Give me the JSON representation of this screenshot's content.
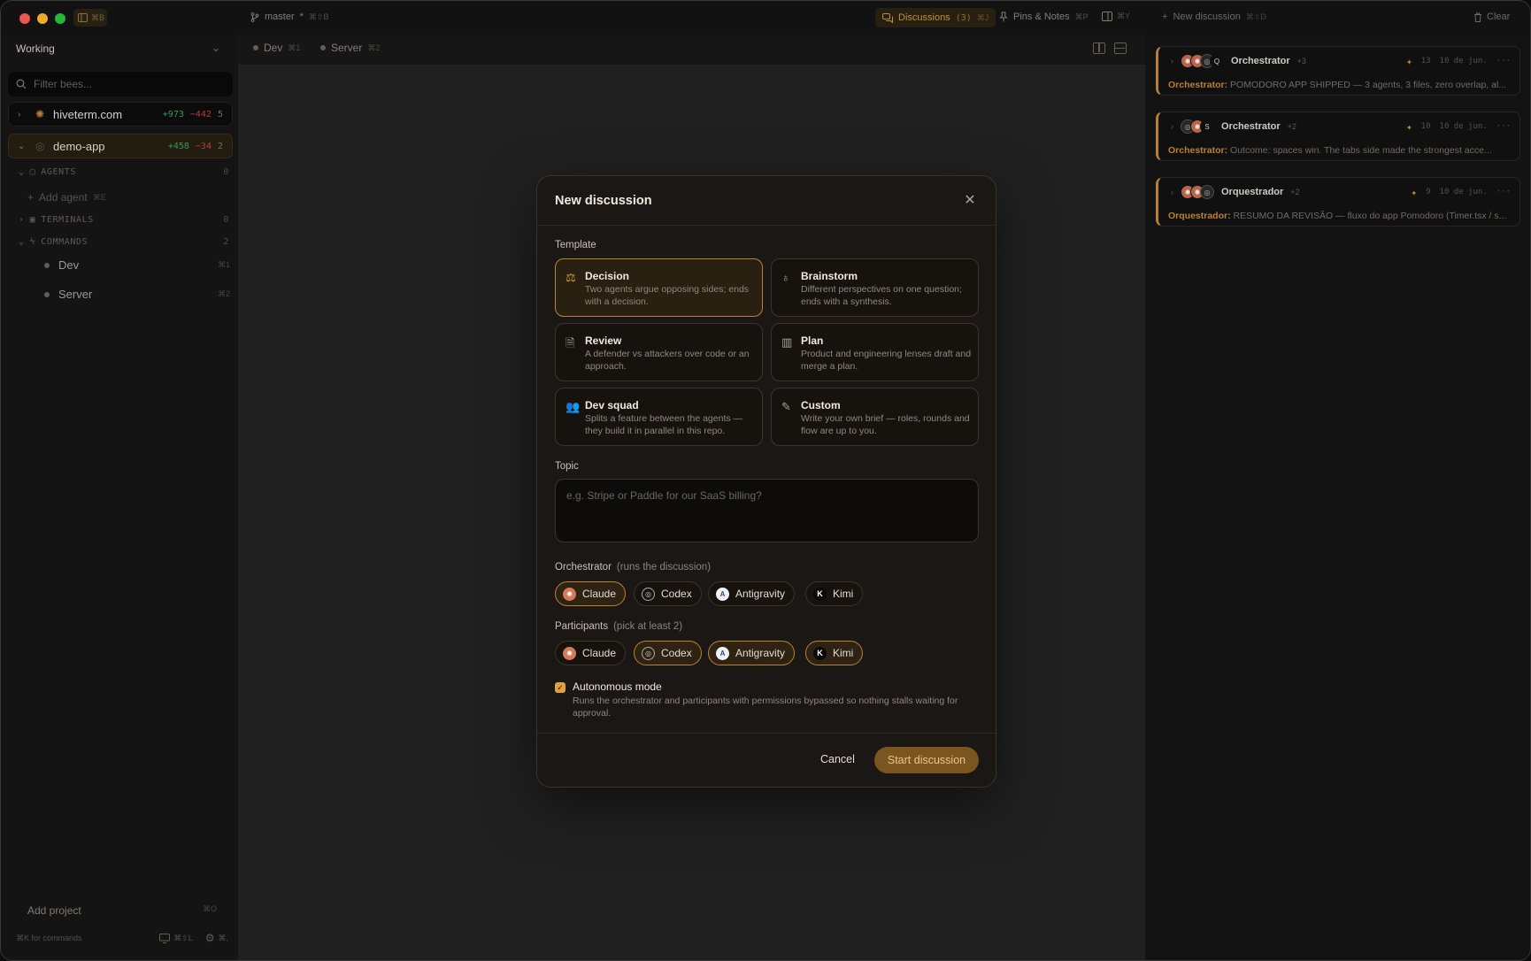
{
  "topbar": {
    "sidebar_kbd": "⌘B",
    "branch": "master",
    "branch_mark": "*",
    "branch_extra": "⌘⇧B",
    "discussions_label": "Discussions",
    "discussions_count": "(3)",
    "discussions_kbd": "⌘J",
    "pins_label": "Pins & Notes",
    "pins_kbd": "⌘P",
    "panel_kbd": "⌘Y",
    "new_discussion_label": "New discussion",
    "new_discussion_kbd": "⌘⇧D",
    "clear_label": "Clear"
  },
  "sidebar": {
    "workspace": "Working",
    "filter_placeholder": "Filter bees...",
    "projects": [
      {
        "name": "hiveterm.com",
        "added": "+973",
        "removed": "−442",
        "count": "5"
      },
      {
        "name": "demo-app",
        "added": "+458",
        "removed": "−34",
        "count": "2"
      }
    ],
    "agents_label": "AGENTS",
    "agents_count": "0",
    "add_agent": "Add agent",
    "add_agent_kbd": "⌘E",
    "terminals_label": "TERMINALS",
    "terminals_count": "0",
    "commands_label": "COMMANDS",
    "commands_count": "2",
    "commands": [
      {
        "name": "Dev",
        "kbd": "⌘1"
      },
      {
        "name": "Server",
        "kbd": "⌘2"
      }
    ],
    "add_project": "Add project",
    "add_project_kbd": "⌘O",
    "footer_hint": "⌘K for commands",
    "footer_kbd1": "⌘⇧L",
    "footer_kbd2": "⌘,"
  },
  "tabs": [
    {
      "label": "Dev",
      "kbd": "⌘1"
    },
    {
      "label": "Server",
      "kbd": "⌘2"
    }
  ],
  "discussions": [
    {
      "name": "Orchestrator",
      "plus": "+3",
      "count": "13",
      "date": "10 de jun.",
      "speaker": "Orchestrator:",
      "text": " POMODORO APP SHIPPED — 3 agents, 3 files, zero overlap, al..."
    },
    {
      "name": "Orchestrator",
      "plus": "+2",
      "count": "10",
      "date": "10 de jun.",
      "speaker": "Orchestrator:",
      "text": " Outcome: spaces win. The tabs side made the strongest acce..."
    },
    {
      "name": "Orquestrador",
      "plus": "+2",
      "count": "9",
      "date": "10 de jun.",
      "speaker": "Orquestrador:",
      "text": " RESUMO DA REVISÃO — fluxo do app Pomodoro (Timer.tsx / s..."
    }
  ],
  "modal": {
    "title": "New discussion",
    "template_label": "Template",
    "templates": [
      {
        "name": "Decision",
        "desc": "Two agents argue opposing sides; ends with a decision.",
        "icon": "scale-icon",
        "selected": true
      },
      {
        "name": "Brainstorm",
        "desc": "Different perspectives on one question; ends with a synthesis.",
        "icon": "lightbulb-icon",
        "selected": false
      },
      {
        "name": "Review",
        "desc": "A defender vs attackers over code or an approach.",
        "icon": "document-search-icon",
        "selected": false
      },
      {
        "name": "Plan",
        "desc": "Product and engineering lenses draft and merge a plan.",
        "icon": "map-icon",
        "selected": false
      },
      {
        "name": "Dev squad",
        "desc": "Splits a feature between the agents — they build it in parallel in this repo.",
        "icon": "users-icon",
        "selected": false
      },
      {
        "name": "Custom",
        "desc": "Write your own brief — roles, rounds and flow are up to you.",
        "icon": "pencil-icon",
        "selected": false
      }
    ],
    "topic_label": "Topic",
    "topic_placeholder": "e.g. Stripe or Paddle for our SaaS billing?",
    "orchestrator_label": "Orchestrator",
    "orchestrator_sub": "(runs the discussion)",
    "orchestrator_options": [
      {
        "name": "Claude",
        "selected": true
      },
      {
        "name": "Codex",
        "selected": false
      },
      {
        "name": "Antigravity",
        "selected": false
      },
      {
        "name": "Kimi",
        "selected": false
      }
    ],
    "participants_label": "Participants",
    "participants_sub": "(pick at least 2)",
    "participant_options": [
      {
        "name": "Claude",
        "selected": false
      },
      {
        "name": "Codex",
        "selected": true
      },
      {
        "name": "Antigravity",
        "selected": true
      },
      {
        "name": "Kimi",
        "selected": true
      }
    ],
    "autonomous_title": "Autonomous mode",
    "autonomous_desc": "Runs the orchestrator and participants with permissions bypassed so nothing stalls waiting for approval.",
    "autonomous_checked": true,
    "cancel_label": "Cancel",
    "start_label": "Start discussion"
  },
  "colors": {
    "accent": "#d49a3c",
    "accent_dark": "#7a5520",
    "added": "#3aa85a",
    "removed": "#c2453f"
  }
}
